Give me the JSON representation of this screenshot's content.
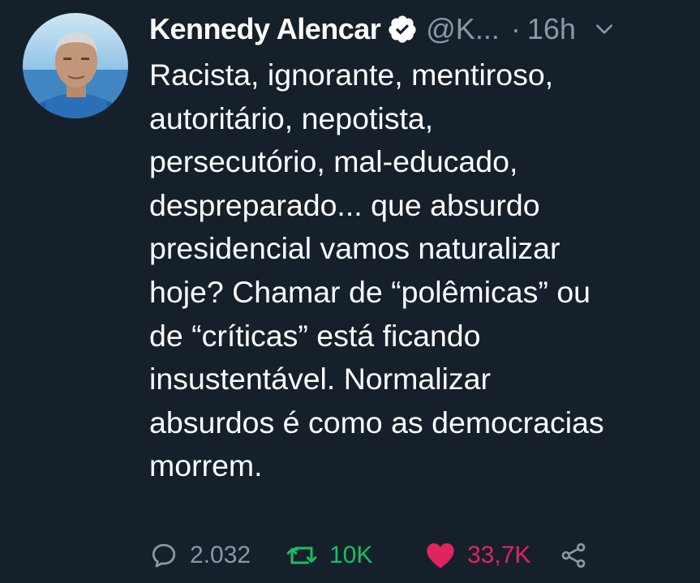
{
  "tweet": {
    "author_name": "Kennedy Alencar",
    "handle": "@K...",
    "separator": "·",
    "time": "16h",
    "text_lines": [
      "Racista, ignorante, mentiroso,",
      "autoritário, nepotista,",
      "persecutório, mal-educado,",
      "despreparado... que absurdo",
      "presidencial vamos naturalizar",
      "hoje? Chamar de “polêmicas” ou",
      "de “críticas” está ficando",
      "insustentável. Normalizar",
      "absurdos é como as democracias",
      "morrem."
    ]
  },
  "actions": {
    "reply_count": "2.032",
    "retweet_count": "10K",
    "like_count": "33,7K"
  },
  "icons": {
    "verified": "verified-badge-icon",
    "more": "chevron-down-icon",
    "reply": "reply-icon",
    "retweet": "retweet-icon",
    "like": "heart-icon",
    "share": "share-icon"
  },
  "colors": {
    "background": "#15202b",
    "text": "#ffffff",
    "muted": "#8899a6",
    "retweet_green": "#17bf63",
    "like_red": "#e0245e"
  }
}
